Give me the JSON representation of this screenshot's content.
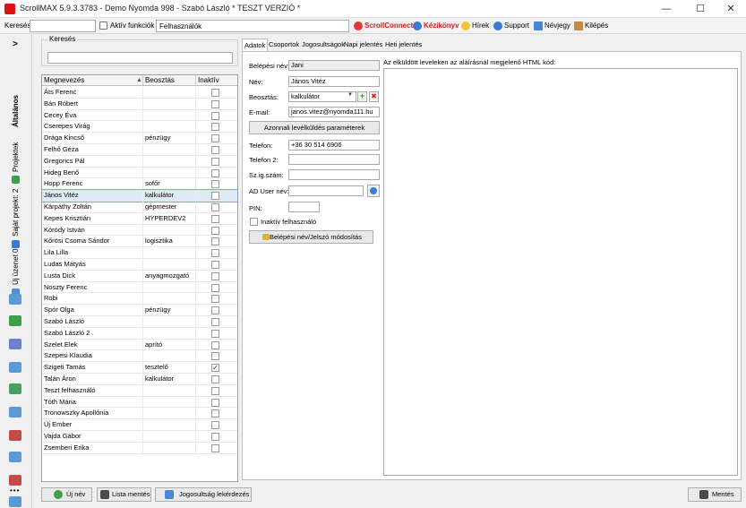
{
  "window": {
    "title": "ScrollMAX 5.9.3.3783 - Demo Nyomda 998 - Szabó László * TESZT VERZIÓ *",
    "minimize": "—",
    "maximize": "☐",
    "close": "✕"
  },
  "toolbar": {
    "search_label": "Keresés",
    "search_value": "",
    "active_functions_label": "Aktív funkciók",
    "active_functions_value": "Felhasználók",
    "links": [
      {
        "label": "ScrollConnect",
        "icon": "scrollconnect-icon",
        "color": "#d02020"
      },
      {
        "label": "Kézikönyv",
        "icon": "manual-icon",
        "color": "#d02020"
      },
      {
        "label": "Hírek",
        "icon": "news-icon",
        "color": "#000000"
      },
      {
        "label": "Support",
        "icon": "help-icon",
        "color": "#000000"
      },
      {
        "label": "Névjegy",
        "icon": "star-icon",
        "color": "#000000"
      },
      {
        "label": "Kilépés",
        "icon": "exit-icon",
        "color": "#000000"
      }
    ]
  },
  "leftbar": {
    "collapse": ">",
    "tabs": [
      "Általános",
      "Projektek",
      "Saját projekt: 2",
      "Új üzenet 0"
    ],
    "more": "•••"
  },
  "userlist": {
    "search_legend": "Keresés",
    "search_value": "",
    "columns": [
      "Megnevezés",
      "Beosztás",
      "Inaktív"
    ],
    "rows": [
      {
        "name": "Áts Ferenc",
        "role": "",
        "inactive": false
      },
      {
        "name": "Bán Róbert",
        "role": "",
        "inactive": false
      },
      {
        "name": "Cecey Éva",
        "role": "",
        "inactive": false
      },
      {
        "name": "Cserepes Virág",
        "role": "",
        "inactive": false
      },
      {
        "name": "Drága Kincső",
        "role": "pénzügy",
        "inactive": false
      },
      {
        "name": "Felhő Géza",
        "role": "",
        "inactive": false
      },
      {
        "name": "Gregorics Pál",
        "role": "",
        "inactive": false
      },
      {
        "name": "Hideg Benő",
        "role": "",
        "inactive": false
      },
      {
        "name": "Hopp Ferenc",
        "role": "sofőr",
        "inactive": false
      },
      {
        "name": "János Vitéz",
        "role": "kalkulátor",
        "inactive": false,
        "selected": true
      },
      {
        "name": "Kárpáthy Zoltán",
        "role": "gépmester",
        "inactive": false
      },
      {
        "name": "Kepes Krisztián",
        "role": "HYPERDEV2",
        "inactive": false
      },
      {
        "name": "Kóródy István",
        "role": "",
        "inactive": false
      },
      {
        "name": "Kőrösi Csoma Sándor",
        "role": "logisztika",
        "inactive": false
      },
      {
        "name": "Lila Lilla",
        "role": "",
        "inactive": false
      },
      {
        "name": "Ludas Mátyás",
        "role": "",
        "inactive": false
      },
      {
        "name": "Lusta Dick",
        "role": "anyagmozgató",
        "inactive": false
      },
      {
        "name": "Noszty Ferenc",
        "role": "",
        "inactive": false
      },
      {
        "name": "Robi",
        "role": "",
        "inactive": false
      },
      {
        "name": "Spór Olga",
        "role": "pénzügy",
        "inactive": false
      },
      {
        "name": "Szabó László",
        "role": "",
        "inactive": false
      },
      {
        "name": "Szabó László 2",
        "role": "",
        "inactive": false
      },
      {
        "name": "Szelet Elek",
        "role": "aprító",
        "inactive": false
      },
      {
        "name": "Szepesi Klaudia",
        "role": "",
        "inactive": false
      },
      {
        "name": "Szigeti Tamás",
        "role": "tesztelő",
        "inactive": true
      },
      {
        "name": "Talán Áron",
        "role": "kalkulátor",
        "inactive": false
      },
      {
        "name": "Teszt felhasználó",
        "role": "",
        "inactive": false
      },
      {
        "name": "Tóth Mária",
        "role": "",
        "inactive": false
      },
      {
        "name": "Tronowszky Apollónia",
        "role": "",
        "inactive": false
      },
      {
        "name": "Új Ember",
        "role": "",
        "inactive": false
      },
      {
        "name": "Vajda Gábor",
        "role": "",
        "inactive": false
      },
      {
        "name": "Zsemberi Erika",
        "role": "",
        "inactive": false
      }
    ]
  },
  "tabs": [
    "Adatok",
    "Csoportok",
    "Jogosultságok",
    "Napi jelentés",
    "Heti jelentés"
  ],
  "form": {
    "login_label": "Belépési név:",
    "login_value": "Jani",
    "name_label": "Név:",
    "name_value": "János Vitéz",
    "role_label": "Beosztás:",
    "role_value": "kalkulátor",
    "email_label": "E-mail:",
    "email_value": "janos.vitez@nyomda111.hu",
    "email_params_button": "Azonnali levélküldés paraméterek",
    "phone_label": "Telefon:",
    "phone_value": "+36 30 514 6906",
    "phone2_label": "Telefon 2:",
    "phone2_value": "",
    "id_label": "Sz.ig.szám:",
    "id_value": "",
    "ad_label": "AD User név:",
    "ad_value": "",
    "pin_label": "PIN:",
    "pin_value": "",
    "inactive_label": "Inaktív felhasználó",
    "password_button": "Belépési név/Jelszó módosítás",
    "html_label": "Az elküldött leveleken az aláírásnál megjelenő HTML kód:",
    "html_value": ""
  },
  "bottom": {
    "new_button": "Új név",
    "list_button": "Lista mentés",
    "perm_button": "Jogosultság lekérdezés",
    "save_button": "Mentés"
  }
}
